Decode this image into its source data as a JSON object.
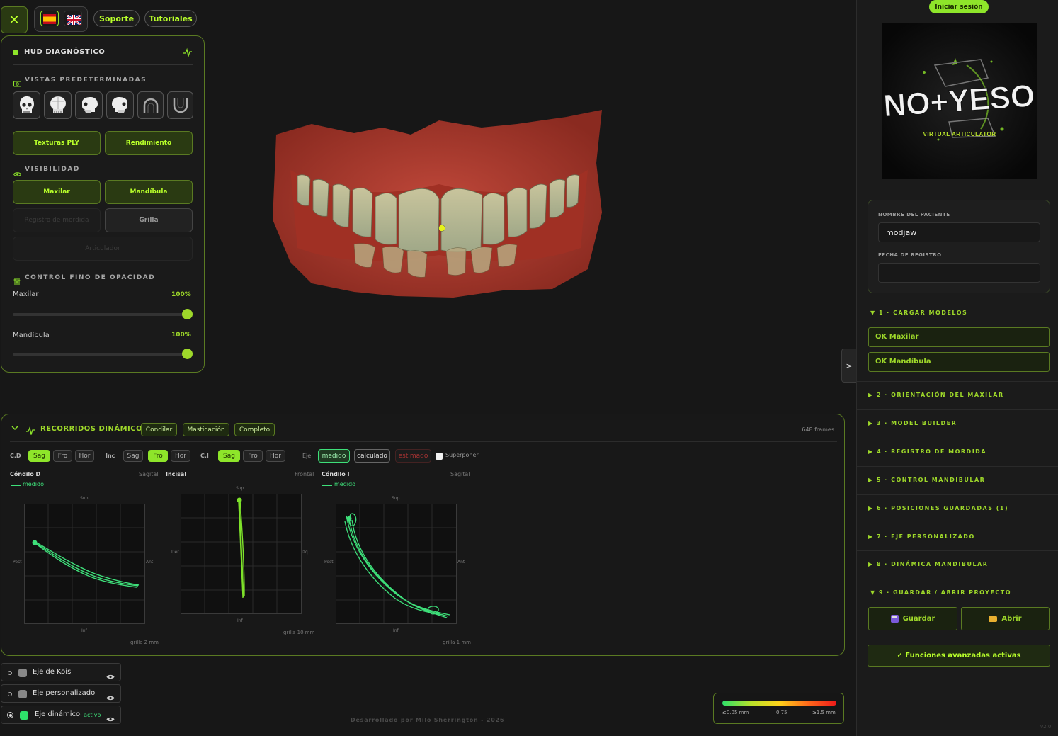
{
  "topbar": {
    "close_icon": "close-icon",
    "support": "Soporte",
    "tutorials": "Tutoriales",
    "flags": [
      "spain-flag-icon",
      "uk-flag-icon"
    ]
  },
  "hud": {
    "title": "HUD DIAGNÓSTICO",
    "views_title": "VISTAS PREDETERMINADAS",
    "view_icons": [
      "skull-front-icon",
      "skull-top-icon",
      "skull-side-left-icon",
      "skull-side-right-icon",
      "upper-arch-icon",
      "lower-arch-icon"
    ],
    "textures_btn": "Texturas PLY",
    "performance_btn": "Rendimiento",
    "visibility_title": "VISIBILIDAD",
    "maxilar_btn": "Maxilar",
    "mandibula_btn": "Mandíbula",
    "bite_btn": "Registro de mordida",
    "grid_btn": "Grilla",
    "articulator_btn": "Articulador",
    "opacity_title": "CONTROL FINO DE OPACIDAD",
    "opacity_maxilar_label": "Maxilar",
    "opacity_maxilar_value": "100%",
    "opacity_maxilar_level": 1.0,
    "opacity_mandibula_label": "Mandíbula",
    "opacity_mandibula_value": "100%",
    "opacity_mandibula_level": 1.0
  },
  "dynamics": {
    "title": "RECORRIDOS DINÁMICOS",
    "tabs": [
      "Condilar",
      "Masticación",
      "Completo"
    ],
    "frames": "648 frames",
    "cd_label": "C.D",
    "inc_label": "Inc",
    "ci_label": "C.I",
    "views": [
      "Sag",
      "Fro",
      "Hor"
    ],
    "axis_label": "Eje:",
    "axis_options": [
      "medido",
      "calculado",
      "estimado"
    ],
    "superpose": "Superponer",
    "plots": [
      {
        "name": "Cóndilo D",
        "view": "Sagital",
        "legend": "medido",
        "top": "Sup",
        "bottom": "Inf",
        "left": "Post",
        "right": "Ant",
        "grid": "grilla 2 mm"
      },
      {
        "name": "Incisal",
        "view": "Frontal",
        "legend": "",
        "top": "Sup",
        "bottom": "Inf",
        "left": "Der",
        "right": "Izq",
        "grid": "grilla 10 mm"
      },
      {
        "name": "Cóndilo I",
        "view": "Sagital",
        "legend": "medido",
        "top": "Sup",
        "bottom": "Inf",
        "left": "Post",
        "right": "Ant",
        "grid": "grilla 1 mm"
      }
    ]
  },
  "axes": [
    {
      "label": "Eje de Kois",
      "status": ""
    },
    {
      "label": "Eje personalizado",
      "status": ""
    },
    {
      "label": "Eje dinámico",
      "status": "· activo"
    }
  ],
  "colorbar": {
    "min": "≤0.05 mm",
    "mid": "0.75",
    "max": "≥1.5 mm"
  },
  "footer": "Desarrollado por Milo Sherrington - 2026",
  "version": "v2.0",
  "sidebar": {
    "login": "Iniciar sesión",
    "logo_text": "NO+YESO",
    "logo_sub": "VIRTUAL ARTICULATOR",
    "patient_label": "NOMBRE DEL PACIENTE",
    "patient_value": "modjaw",
    "date_label": "FECHA DE REGISTRO",
    "date_value": "",
    "collapse_arrow": ">",
    "step1": "▼ 1 · CARGAR MODELOS",
    "ok_maxilar": "OK Maxilar",
    "ok_mandibula": "OK Mandíbula",
    "steps": [
      "▶ 2 · ORIENTACIÓN DEL MAXILAR",
      "▶ 3 · MODEL BUILDER",
      "▶ 4 · REGISTRO DE MORDIDA",
      "▶ 5 · CONTROL MANDIBULAR",
      "▶ 6 · POSICIONES GUARDADAS (1)",
      "▶ 7 · EJE PERSONALIZADO",
      "▶ 8 · DINÁMICA MANDIBULAR"
    ],
    "step9": "▼ 9 · GUARDAR / ABRIR PROYECTO",
    "save_btn": "Guardar",
    "open_btn": "Abrir",
    "advanced_btn": "✓ Funciones avanzadas activas"
  }
}
